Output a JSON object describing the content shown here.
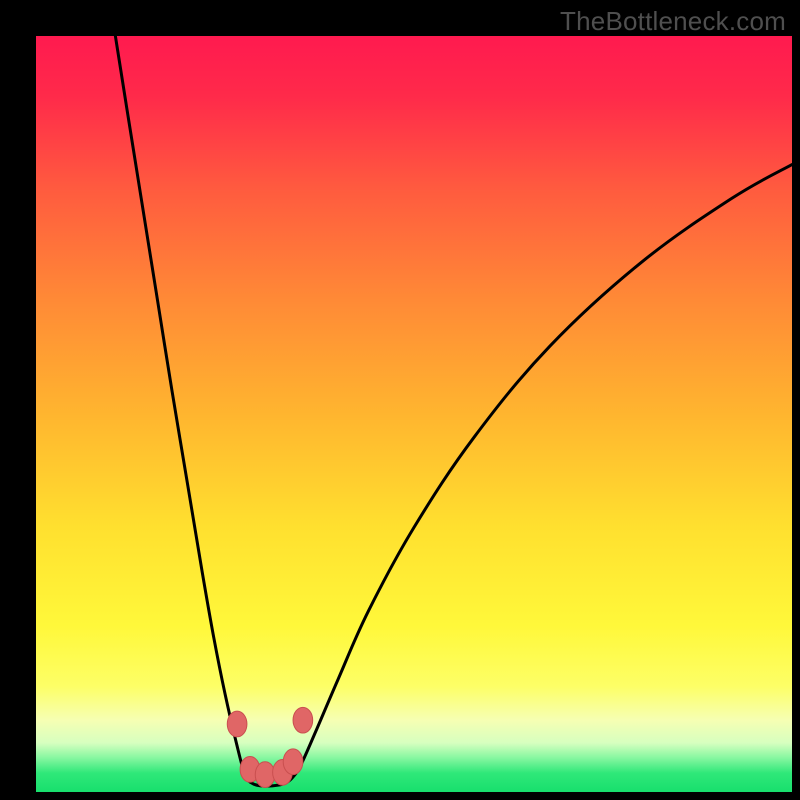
{
  "watermark": "TheBottleneck.com",
  "colors": {
    "bg": "#000000",
    "curve": "#000000",
    "marker_fill": "#e06666",
    "marker_stroke": "#c94f4f",
    "gradient_stops": [
      {
        "offset": 0.0,
        "color": "#ff1a4f"
      },
      {
        "offset": 0.08,
        "color": "#ff2a4a"
      },
      {
        "offset": 0.2,
        "color": "#ff5a3f"
      },
      {
        "offset": 0.35,
        "color": "#ff8a36"
      },
      {
        "offset": 0.5,
        "color": "#ffb52f"
      },
      {
        "offset": 0.65,
        "color": "#ffe02f"
      },
      {
        "offset": 0.78,
        "color": "#fff83a"
      },
      {
        "offset": 0.86,
        "color": "#fdff66"
      },
      {
        "offset": 0.905,
        "color": "#f6ffb3"
      },
      {
        "offset": 0.935,
        "color": "#d7ffbf"
      },
      {
        "offset": 0.955,
        "color": "#86f7a0"
      },
      {
        "offset": 0.975,
        "color": "#2fe879"
      },
      {
        "offset": 1.0,
        "color": "#18df6d"
      }
    ]
  },
  "chart_data": {
    "type": "line",
    "title": "",
    "xlabel": "",
    "ylabel": "",
    "xlim": [
      0,
      100
    ],
    "ylim": [
      0,
      100
    ],
    "grid": false,
    "series": [
      {
        "name": "left-curve",
        "x": [
          10.5,
          12,
          14,
          16,
          18,
          20,
          22,
          23.5,
          25,
          26.5,
          27.6
        ],
        "y": [
          100,
          90.5,
          78,
          65.5,
          53,
          41,
          29,
          20.5,
          13,
          6.5,
          2.4
        ]
      },
      {
        "name": "right-curve",
        "x": [
          34,
          35,
          37,
          40,
          44,
          50,
          58,
          68,
          80,
          92,
          100
        ],
        "y": [
          2,
          3.5,
          8,
          15,
          24,
          35,
          47,
          59,
          70,
          78.5,
          83
        ]
      },
      {
        "name": "bottom-arc",
        "x": [
          27.6,
          28.5,
          30,
          32,
          33.2,
          34
        ],
        "y": [
          2.4,
          1.2,
          0.8,
          0.9,
          1.3,
          2
        ]
      }
    ],
    "markers": {
      "name": "highlight-points",
      "points": [
        {
          "x": 26.6,
          "y": 9.0
        },
        {
          "x": 28.3,
          "y": 3.0
        },
        {
          "x": 30.3,
          "y": 2.3
        },
        {
          "x": 32.6,
          "y": 2.6
        },
        {
          "x": 34.0,
          "y": 4.0
        },
        {
          "x": 35.3,
          "y": 9.5
        }
      ],
      "rx": 1.3,
      "ry": 1.7
    }
  }
}
